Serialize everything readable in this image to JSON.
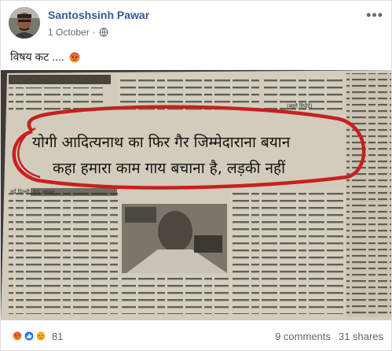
{
  "post": {
    "author": "Santoshsinh Pawar",
    "date": "1 October",
    "privacy_icon": "globe-icon",
    "more_icon": "more-options-icon",
    "text": "विषय कट ....",
    "text_emoji": "angry-emoji"
  },
  "newspaper": {
    "headline_line1": "योगी आदित्यनाथ का फिर गैर जिम्मेदाराना बयान",
    "headline_line2": "कहा हमारा काम गाय बचाना है, लड़की नहीं",
    "dateline_left": "नई दिल्ली, 01 अगस्त",
    "bureau_label": "(ब्यूरो रिपोर्ट)"
  },
  "footer": {
    "reaction_icons": [
      "angry-reaction-icon",
      "like-reaction-icon",
      "sad-reaction-icon"
    ],
    "reaction_count": "81",
    "comments": "9 comments",
    "shares": "31 shares"
  },
  "colors": {
    "author_link": "#385898",
    "circle_red": "#c8201f",
    "newsprint": "#d2ccbc"
  }
}
